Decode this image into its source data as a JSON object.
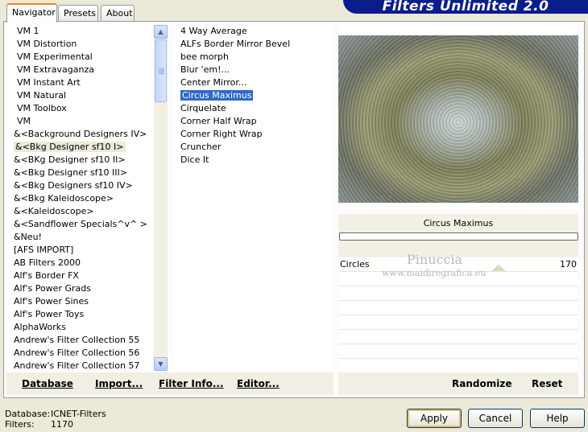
{
  "tabs": [
    {
      "label": "Navigator",
      "active": true
    },
    {
      "label": "Presets",
      "active": false
    },
    {
      "label": "About",
      "active": false
    }
  ],
  "banner": "Filters Unlimited 2.0",
  "categories": [
    "VM 1",
    "VM Distortion",
    "VM Experimental",
    "VM Extravaganza",
    "VM Instant Art",
    "VM Natural",
    "VM Toolbox",
    "VM",
    "&<Background Designers IV>",
    "&<Bkg Designer sf10 I>",
    "&<BKg Designer sf10 II>",
    "&<Bkg Designer sf10 III>",
    "&<Bkg Designers sf10 IV>",
    "&<Bkg Kaleidoscope>",
    "&<Kaleidoscope>",
    "&<Sandflower Specials^v^ >",
    "&Neu!",
    "[AFS IMPORT]",
    "AB Filters 2000",
    "Alf's Border FX",
    "Alf's Power Grads",
    "Alf's Power Sines",
    "Alf's Power Toys",
    "AlphaWorks",
    "Andrew's Filter Collection 55",
    "Andrew's Filter Collection 56",
    "Andrew's Filter Collection 57"
  ],
  "selected_category": "&<Bkg Designer sf10 I>",
  "filters": [
    "4 Way Average",
    "ALFs Border Mirror Bevel",
    "bee morph",
    "Blur 'em!...",
    "Center Mirror...",
    "Circus Maximus",
    "Cirquelate",
    "Corner Half Wrap",
    "Corner Right Wrap",
    "Cruncher",
    "Dice It"
  ],
  "selected_filter": "Circus Maximus",
  "preview": {
    "filter_title": "Circus Maximus"
  },
  "params": [
    {
      "label": "Circles",
      "value": "170"
    }
  ],
  "watermark": {
    "line1": "Pinuccia",
    "line2": "www.maidiregrafica.eu"
  },
  "left_buttons": {
    "database": "Database",
    "import": "Import...",
    "filter_info": "Filter Info...",
    "editor": "Editor..."
  },
  "right_buttons": {
    "randomize": "Randomize",
    "reset": "Reset"
  },
  "status": {
    "database_label": "Database:",
    "database_value": "ICNET-Filters",
    "filters_label": "Filters:",
    "filters_value": "1170"
  },
  "dialog": {
    "apply": "Apply",
    "cancel": "Cancel",
    "help": "Help"
  },
  "colors": {
    "banner": "#0a1d8a",
    "selection": "#316ac5",
    "tab_accent": "#e68b2c"
  }
}
